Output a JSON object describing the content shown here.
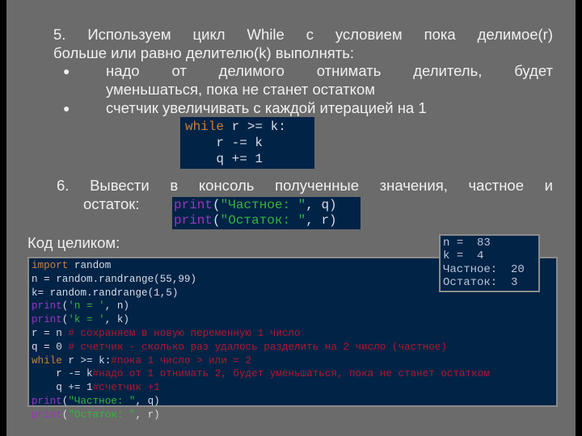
{
  "step5": {
    "line1": "5. Используем цикл While с условием пока делимое(r)",
    "line2": "больше или равно делителю(k) выполнять:",
    "bullets": [
      {
        "line1": "надо от делимого отнимать делитель, будет",
        "line2": "уменьшаться, пока не станет остатком"
      },
      {
        "line1": "счетчик увеличивать с каждой итерацией на 1"
      }
    ],
    "bullet_glyph": "●"
  },
  "while_code": {
    "line1_kw": "while",
    "line1_rest": " r >= k:",
    "line2": "    r -= k",
    "line3": "    q += 1"
  },
  "step6": {
    "line1": "6. Вывести в консоль полученные значения, частное и",
    "line2": "остаток:"
  },
  "print_code": {
    "fn": "print",
    "line1_open": "(",
    "line1_str": "\"Частное: \"",
    "line1_rest": ", q)",
    "line2_open": "(",
    "line2_str": "\"Остаток: \"",
    "line2_rest": ", r)"
  },
  "full_code_label": "Код целиком:",
  "full_code": {
    "l1_kw": "import",
    "l1_rest": " random",
    "l2": "n = random.randrange(55,99)",
    "l3": "k= random.randrange(1,5)",
    "l4_fn": "print",
    "l4_open": "(",
    "l4_str": "'n = '",
    "l4_rest": ", n)",
    "l5_fn": "print",
    "l5_open": "(",
    "l5_str": "'k = '",
    "l5_rest": ", k)",
    "l6_code": "r = n ",
    "l6_cm": "# сохраняем в новую переменную 1 число",
    "l7_code": "q = 0 ",
    "l7_cm": "# счетчик - сколько раз удалось разделить на 2 число (частное)",
    "l8_kw": "while",
    "l8_code": " r >= k:",
    "l8_cm": "#пока 1 число > или = 2",
    "l9_code": "    r -= k",
    "l9_cm": "#надо от 1 отнимать 2, будет уменьшаться, пока не станет остатком",
    "l10_code": "    q += 1",
    "l10_cm": "#счетчик +1",
    "l11_fn": "print",
    "l11_open": "(",
    "l11_str": "\"Частное: \"",
    "l11_rest": ", q)",
    "l12_fn": "print",
    "l12_open": "(",
    "l12_str": "\"Остаток: \"",
    "l12_rest": ", r)"
  },
  "output": {
    "lines": [
      "n =  83",
      "k =  4",
      "Частное:  20",
      "Остаток:  3"
    ]
  },
  "colors": {
    "slide_bg": "#6b6b6b",
    "code_bg": "#002346",
    "keyword": "#c8803c",
    "builtin": "#9a36c4",
    "string": "#35b540",
    "comment": "#b01830"
  }
}
